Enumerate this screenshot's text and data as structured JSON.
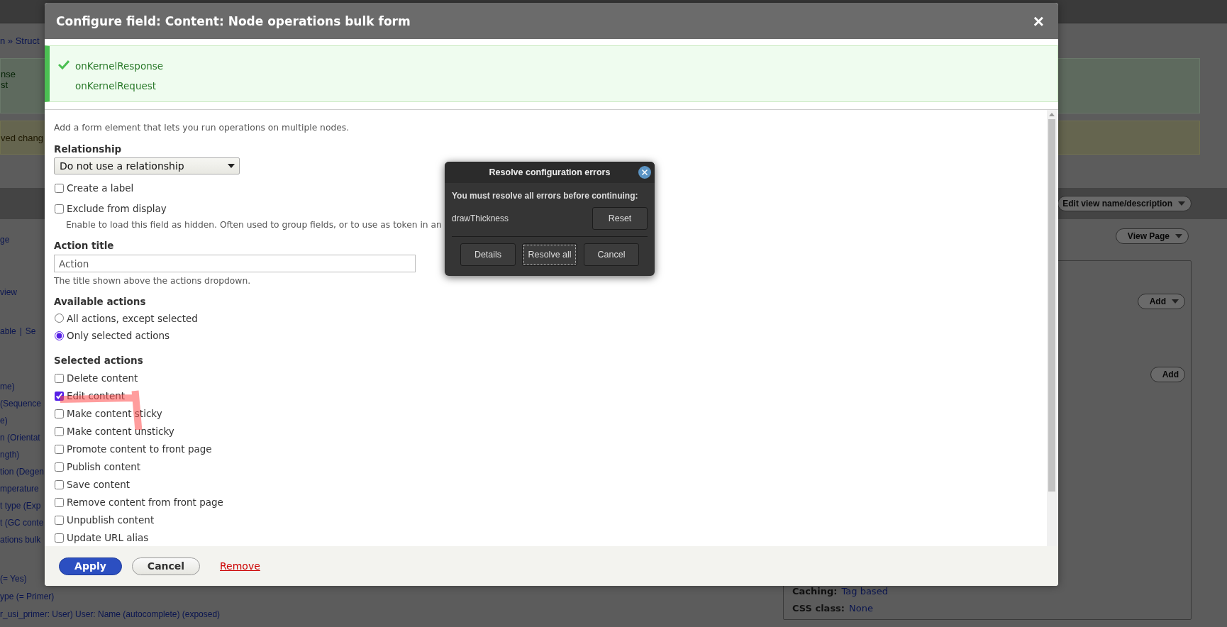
{
  "background": {
    "breadcrumb": "n » Struct",
    "status_lines": [
      "nse",
      "st"
    ],
    "warning": "ved chang",
    "display_links": [
      "ge",
      "view"
    ],
    "filter_links": [
      "able",
      "Se"
    ],
    "separator": "|",
    "fields": [
      "me)",
      "(Sequence",
      "e)",
      "n (Orientat",
      "ngth)",
      "tion (Degen",
      "mperature",
      "t type (Exp",
      "t (GC conte",
      "ations bulk"
    ],
    "filters": [
      "(= Yes)",
      "ype (= Primer)",
      "r_usi_primer: User) User: Name (autocomplete) (exposed)"
    ],
    "edit_button": {
      "label": "Edit view name/description",
      "has_menu": true
    },
    "view_button": {
      "label": "View Page",
      "has_menu": true
    },
    "add_buttons": [
      {
        "label": "Add",
        "has_menu": true
      },
      {
        "label": "Add",
        "has_menu": false
      }
    ],
    "settings": [
      {
        "label": "Caching:",
        "value": "Tag based"
      },
      {
        "label": "CSS class:",
        "value": "None"
      }
    ]
  },
  "dialog": {
    "title": "Configure field: Content: Node operations bulk form",
    "close": "×",
    "messages": [
      "onKernelResponse",
      "onKernelRequest"
    ],
    "description": "Add a form element that lets you run operations on multiple nodes.",
    "relationship": {
      "label": "Relationship",
      "value": "Do not use a relationship"
    },
    "options": [
      {
        "label": "Create a label",
        "checked": false
      },
      {
        "label": "Exclude from display",
        "checked": false
      }
    ],
    "exclude_help": "Enable to load this field as hidden. Often used to group fields, or to use as token in an",
    "action_title": {
      "label": "Action title",
      "value": "Action",
      "help": "The title shown above the actions dropdown."
    },
    "available_actions": {
      "label": "Available actions",
      "options": [
        {
          "label": "All actions, except selected",
          "selected": false
        },
        {
          "label": "Only selected actions",
          "selected": true
        }
      ]
    },
    "selected_actions": {
      "label": "Selected actions",
      "items": [
        {
          "label": "Delete content",
          "checked": false
        },
        {
          "label": "Edit content",
          "checked": true
        },
        {
          "label": "Make content sticky",
          "checked": false
        },
        {
          "label": "Make content unsticky",
          "checked": false
        },
        {
          "label": "Promote content to front page",
          "checked": false
        },
        {
          "label": "Publish content",
          "checked": false
        },
        {
          "label": "Save content",
          "checked": false
        },
        {
          "label": "Remove content from front page",
          "checked": false
        },
        {
          "label": "Unpublish content",
          "checked": false
        },
        {
          "label": "Update URL alias",
          "checked": false
        }
      ]
    },
    "buttons": {
      "apply": "Apply",
      "cancel": "Cancel",
      "remove": "Remove"
    }
  },
  "error_dialog": {
    "title": "Resolve configuration errors",
    "message": "You must resolve all errors before continuing:",
    "errors": [
      {
        "name": "drawThickness",
        "action": "Reset"
      }
    ],
    "buttons": [
      {
        "label": "Details",
        "focused": false
      },
      {
        "label": "Resolve all",
        "focused": true
      },
      {
        "label": "Cancel",
        "focused": false
      }
    ]
  }
}
